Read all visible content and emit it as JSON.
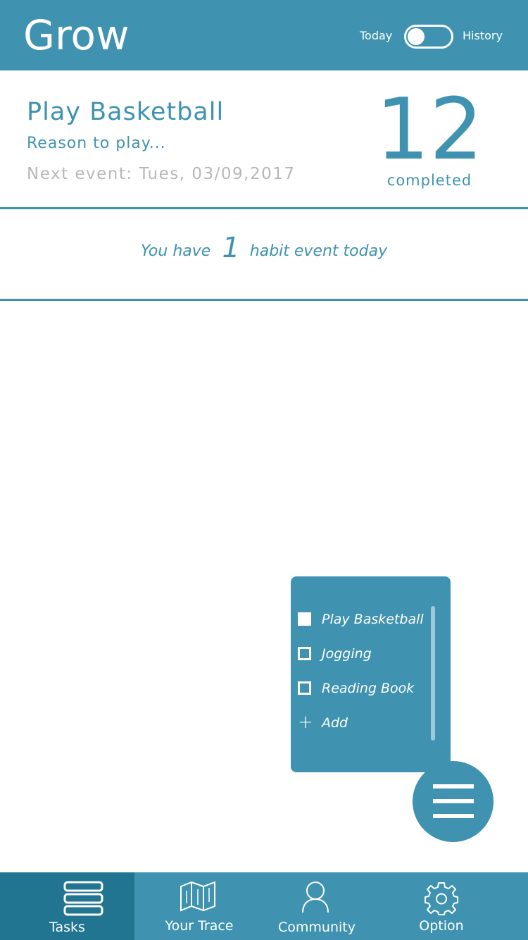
{
  "header": {
    "title": "Grow",
    "toggle_left_label": "Today",
    "toggle_right_label": "History",
    "toggle_state": "Today"
  },
  "habit": {
    "name": "Play Basketball",
    "reason": "Reason to play...",
    "next_event": "Next event: Tues, 03/09,2017",
    "completed_count": "12",
    "completed_label": "completed"
  },
  "today_notice": {
    "prefix": "You have",
    "count": "1",
    "suffix": "habit event today"
  },
  "habit_menu": {
    "items": [
      {
        "label": "Play Basketball",
        "checked": true
      },
      {
        "label": "Jogging",
        "checked": false
      },
      {
        "label": "Reading Book",
        "checked": false
      }
    ],
    "add_label": "Add"
  },
  "fab": {
    "icon": "menu-icon"
  },
  "nav": {
    "items": [
      {
        "label": "Tasks",
        "icon": "tasks-icon",
        "active": true
      },
      {
        "label": "Your Trace",
        "icon": "map-icon",
        "active": false
      },
      {
        "label": "Community",
        "icon": "person-icon",
        "active": false
      },
      {
        "label": "Option",
        "icon": "gear-icon",
        "active": false
      }
    ]
  },
  "colors": {
    "primary": "#3f93b0",
    "nav_active": "#217591",
    "muted_text": "#b8b8b8",
    "background": "#ffffff"
  }
}
